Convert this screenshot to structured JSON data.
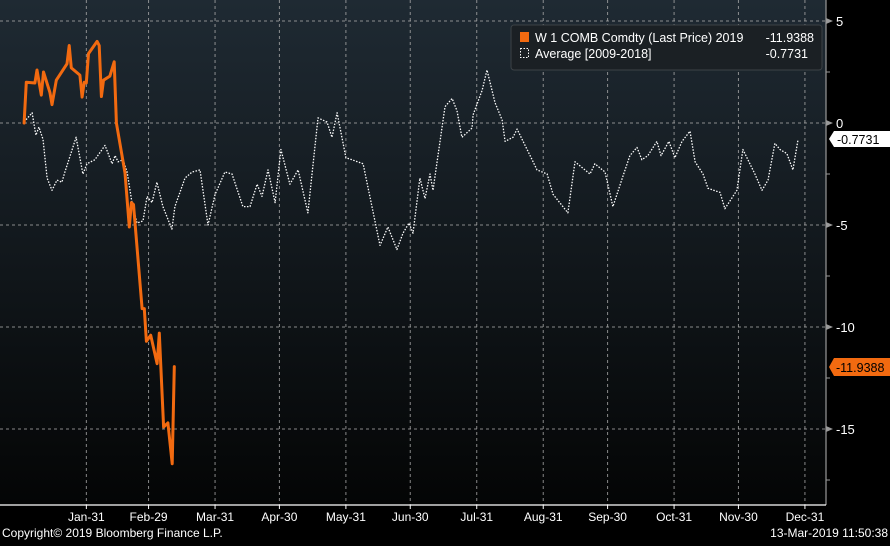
{
  "chart_data": {
    "type": "line",
    "title": "",
    "xlabel": "",
    "ylabel": "",
    "x_unit": "day of year",
    "xlim": [
      0,
      366
    ],
    "ylim": [
      -18.5,
      6
    ],
    "y_ticks": [
      5,
      0,
      -5,
      -10,
      -15
    ],
    "x_ticks": [
      {
        "day": 30,
        "label": "Jan-31"
      },
      {
        "day": 59,
        "label": "Feb-29"
      },
      {
        "day": 90,
        "label": "Mar-31"
      },
      {
        "day": 120,
        "label": "Apr-30"
      },
      {
        "day": 151,
        "label": "May-31"
      },
      {
        "day": 181,
        "label": "Jun-30"
      },
      {
        "day": 212,
        "label": "Jul-31"
      },
      {
        "day": 243,
        "label": "Aug-31"
      },
      {
        "day": 273,
        "label": "Sep-30"
      },
      {
        "day": 304,
        "label": "Oct-31"
      },
      {
        "day": 334,
        "label": "Nov-30"
      },
      {
        "day": 365,
        "label": "Dec-31"
      }
    ],
    "grid": true,
    "legend_position": "top-right",
    "series": [
      {
        "name": "W 1 COMB Comdty (Last Price) 2019",
        "last_value": "-11.9388",
        "color": "#f26a10",
        "style": "solid",
        "points": [
          [
            1,
            0.0
          ],
          [
            2,
            2.0
          ],
          [
            6,
            1.96
          ],
          [
            7,
            2.6
          ],
          [
            9,
            1.37
          ],
          [
            10,
            2.5
          ],
          [
            13,
            1.5
          ],
          [
            14,
            0.9
          ],
          [
            16,
            2.1
          ],
          [
            21,
            2.9
          ],
          [
            22,
            3.8
          ],
          [
            23,
            2.7
          ],
          [
            27,
            2.35
          ],
          [
            28,
            1.27
          ],
          [
            29,
            2.0
          ],
          [
            30,
            1.96
          ],
          [
            31,
            3.4
          ],
          [
            35,
            4.0
          ],
          [
            36,
            3.8
          ],
          [
            37,
            1.3
          ],
          [
            38,
            2.1
          ],
          [
            41,
            2.3
          ],
          [
            43,
            3.0
          ],
          [
            44,
            0.0
          ],
          [
            48,
            -2.45
          ],
          [
            50,
            -5.1
          ],
          [
            51,
            -3.9
          ],
          [
            52,
            -4.0
          ],
          [
            56,
            -9.1
          ],
          [
            57,
            -9.1
          ],
          [
            58,
            -10.7
          ],
          [
            60,
            -10.4
          ],
          [
            63,
            -11.8
          ],
          [
            64,
            -10.3
          ],
          [
            66,
            -14.9
          ],
          [
            68,
            -14.7
          ],
          [
            70,
            -16.7
          ],
          [
            71,
            -11.94
          ]
        ]
      },
      {
        "name": "Average [2009-2018]",
        "last_value": "-0.7731",
        "color": "#ffffff",
        "style": "dotted",
        "points": [
          [
            1,
            0.05
          ],
          [
            4.7,
            0.5
          ],
          [
            6.5,
            -0.6
          ],
          [
            7.9,
            -0.2
          ],
          [
            9.8,
            -0.8
          ],
          [
            11.7,
            -2.7
          ],
          [
            14,
            -3.3
          ],
          [
            16.3,
            -2.8
          ],
          [
            18.6,
            -2.9
          ],
          [
            20,
            -2.4
          ],
          [
            25.2,
            -0.7
          ],
          [
            28.4,
            -2.5
          ],
          [
            30.3,
            -2.0
          ],
          [
            34,
            -1.8
          ],
          [
            38.7,
            -1.1
          ],
          [
            42,
            -2.0
          ],
          [
            43.4,
            -1.6
          ],
          [
            44.8,
            -1.9
          ],
          [
            47.1,
            -1.8
          ],
          [
            49,
            -2.4
          ],
          [
            51.3,
            -3.9
          ],
          [
            53.6,
            -4.9
          ],
          [
            56.4,
            -4.8
          ],
          [
            58.3,
            -3.6
          ],
          [
            60.6,
            -3.9
          ],
          [
            62.9,
            -2.9
          ],
          [
            65.7,
            -4.1
          ],
          [
            69.9,
            -5.2
          ],
          [
            71.3,
            -4.1
          ],
          [
            76,
            -2.7
          ],
          [
            79.3,
            -2.4
          ],
          [
            83,
            -2.3
          ],
          [
            86.7,
            -5.0
          ],
          [
            90,
            -3.5
          ],
          [
            94.6,
            -2.4
          ],
          [
            97.9,
            -2.5
          ],
          [
            103,
            -4.1
          ],
          [
            106.3,
            -4.1
          ],
          [
            109.6,
            -3.0
          ],
          [
            111.9,
            -3.6
          ],
          [
            114.7,
            -2.3
          ],
          [
            118,
            -3.9
          ],
          [
            120.7,
            -1.3
          ],
          [
            124.9,
            -3.0
          ],
          [
            128.7,
            -2.3
          ],
          [
            133.3,
            -4.4
          ],
          [
            138,
            0.25
          ],
          [
            142.2,
            0.05
          ],
          [
            144.5,
            -0.7
          ],
          [
            146.9,
            0.5
          ],
          [
            151,
            -1.7
          ],
          [
            153.8,
            -1.8
          ],
          [
            159,
            -2.0
          ],
          [
            166.9,
            -6.0
          ],
          [
            170.6,
            -5.1
          ],
          [
            174.8,
            -6.2
          ],
          [
            177.6,
            -5.4
          ],
          [
            180.4,
            -4.9
          ],
          [
            182.3,
            -5.4
          ],
          [
            185.5,
            -2.7
          ],
          [
            187.9,
            -3.7
          ],
          [
            190.2,
            -2.5
          ],
          [
            191.6,
            -3.3
          ],
          [
            197.2,
            0.8
          ],
          [
            200.5,
            1.2
          ],
          [
            202.8,
            0.6
          ],
          [
            205.1,
            -0.7
          ],
          [
            209.8,
            -0.25
          ],
          [
            210.3,
            0.4
          ],
          [
            214.5,
            1.6
          ],
          [
            216.8,
            2.6
          ],
          [
            220.5,
            1.0
          ],
          [
            223.8,
            0.15
          ],
          [
            225.2,
            -0.9
          ],
          [
            228.9,
            -0.7
          ],
          [
            230.8,
            -0.3
          ],
          [
            233.6,
            -0.9
          ],
          [
            237.8,
            -1.8
          ],
          [
            240.1,
            -2.3
          ],
          [
            244.8,
            -2.5
          ],
          [
            247.6,
            -3.5
          ],
          [
            254.5,
            -4.4
          ],
          [
            257.8,
            -1.9
          ],
          [
            264.8,
            -2.5
          ],
          [
            267.1,
            -2.0
          ],
          [
            271.8,
            -2.4
          ],
          [
            275.5,
            -4.1
          ],
          [
            280.2,
            -2.6
          ],
          [
            283.4,
            -1.6
          ],
          [
            286.7,
            -1.2
          ],
          [
            289,
            -1.8
          ],
          [
            291.8,
            -1.6
          ],
          [
            296,
            -0.9
          ],
          [
            297.9,
            -1.6
          ],
          [
            301.6,
            -0.9
          ],
          [
            304.4,
            -1.7
          ],
          [
            307.7,
            -0.9
          ],
          [
            311.4,
            -0.4
          ],
          [
            313.8,
            -1.9
          ],
          [
            317.5,
            -2.5
          ],
          [
            319.8,
            -3.2
          ],
          [
            325.4,
            -3.4
          ],
          [
            327.7,
            -4.2
          ],
          [
            333.3,
            -3.3
          ],
          [
            336.1,
            -1.3
          ],
          [
            341.7,
            -2.5
          ],
          [
            345,
            -3.3
          ],
          [
            347.8,
            -2.8
          ],
          [
            351,
            -1.0
          ],
          [
            353.4,
            -1.3
          ],
          [
            356.6,
            -1.5
          ],
          [
            359.4,
            -2.3
          ],
          [
            361.8,
            -0.8
          ]
        ]
      }
    ]
  },
  "legend": {
    "items": [
      {
        "label": "W 1 COMB Comdty (Last Price) 2019",
        "value": "-11.9388"
      },
      {
        "label": "Average [2009-2018]",
        "value": "-0.7731"
      }
    ]
  },
  "y_tick_labels": [
    "5",
    "0",
    "-5",
    "-10",
    "-15"
  ],
  "flags": {
    "average": "-0.7731",
    "last_price": "-11.9388"
  },
  "footer": {
    "copyright": "Copyright© 2019 Bloomberg Finance L.P.",
    "timestamp": "13-Mar-2019 11:50:38"
  },
  "colors": {
    "accent": "#f26a10",
    "average": "#ffffff",
    "axis_text": "#ffffff",
    "bg_top": "#1f2a33",
    "bg_bottom": "#040505"
  }
}
